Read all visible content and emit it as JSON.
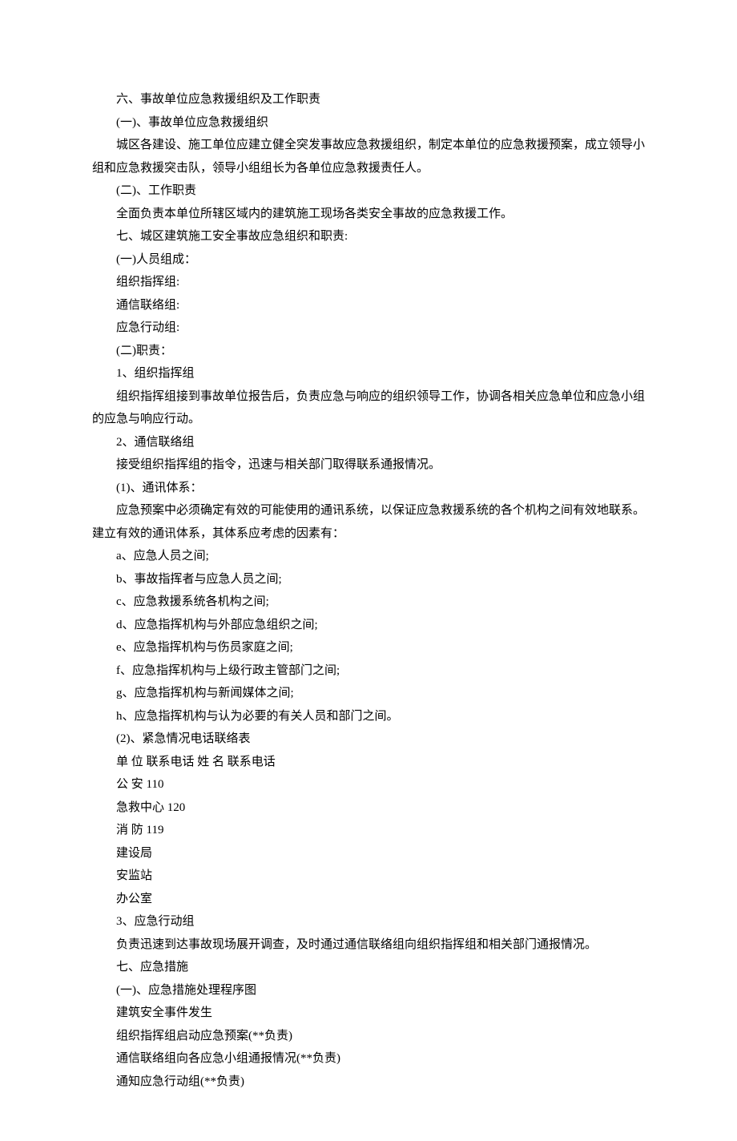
{
  "lines": [
    "六、事故单位应急救援组织及工作职责",
    "(一)、事故单位应急救援组织",
    "城区各建设、施工单位应建立健全突发事故应急救援组织，制定本单位的应急救援预案，成立领导小组和应急救援突击队，领导小组组长为各单位应急救援责任人。",
    "(二)、工作职责",
    "全面负责本单位所辖区域内的建筑施工现场各类安全事故的应急救援工作。",
    "七、城区建筑施工安全事故应急组织和职责:",
    "(一)人员组成：",
    "组织指挥组:",
    "通信联络组:",
    "应急行动组:",
    "(二)职责：",
    "1、组织指挥组",
    "组织指挥组接到事故单位报告后，负责应急与响应的组织领导工作，协调各相关应急单位和应急小组的应急与响应行动。",
    "2、通信联络组",
    "接受组织指挥组的指令，迅速与相关部门取得联系通报情况。",
    "(1)、通讯体系：",
    "应急预案中必须确定有效的可能使用的通讯系统，以保证应急救援系统的各个机构之间有效地联系。建立有效的通讯体系，其体系应考虑的因素有：",
    "a、应急人员之间;",
    "b、事故指挥者与应急人员之间;",
    "c、应急救援系统各机构之间;",
    "d、应急指挥机构与外部应急组织之间;",
    "e、应急指挥机构与伤员家庭之间;",
    "f、应急指挥机构与上级行政主管部门之间;",
    "g、应急指挥机构与新闻媒体之间;",
    "h、应急指挥机构与认为必要的有关人员和部门之间。",
    "(2)、紧急情况电话联络表",
    "单 位 联系电话 姓 名 联系电话",
    "公 安 110",
    "急救中心 120",
    "消 防 119",
    "建设局",
    "安监站",
    "办公室",
    "3、应急行动组",
    "负责迅速到达事故现场展开调查，及时通过通信联络组向组织指挥组和相关部门通报情况。",
    "七、应急措施",
    "(一)、应急措施处理程序图",
    "建筑安全事件发生",
    "组织指挥组启动应急预案(**负责)",
    "通信联络组向各应急小组通报情况(**负责)",
    "通知应急行动组(**负责)"
  ],
  "wrapIndexes": [
    2,
    12,
    16
  ]
}
